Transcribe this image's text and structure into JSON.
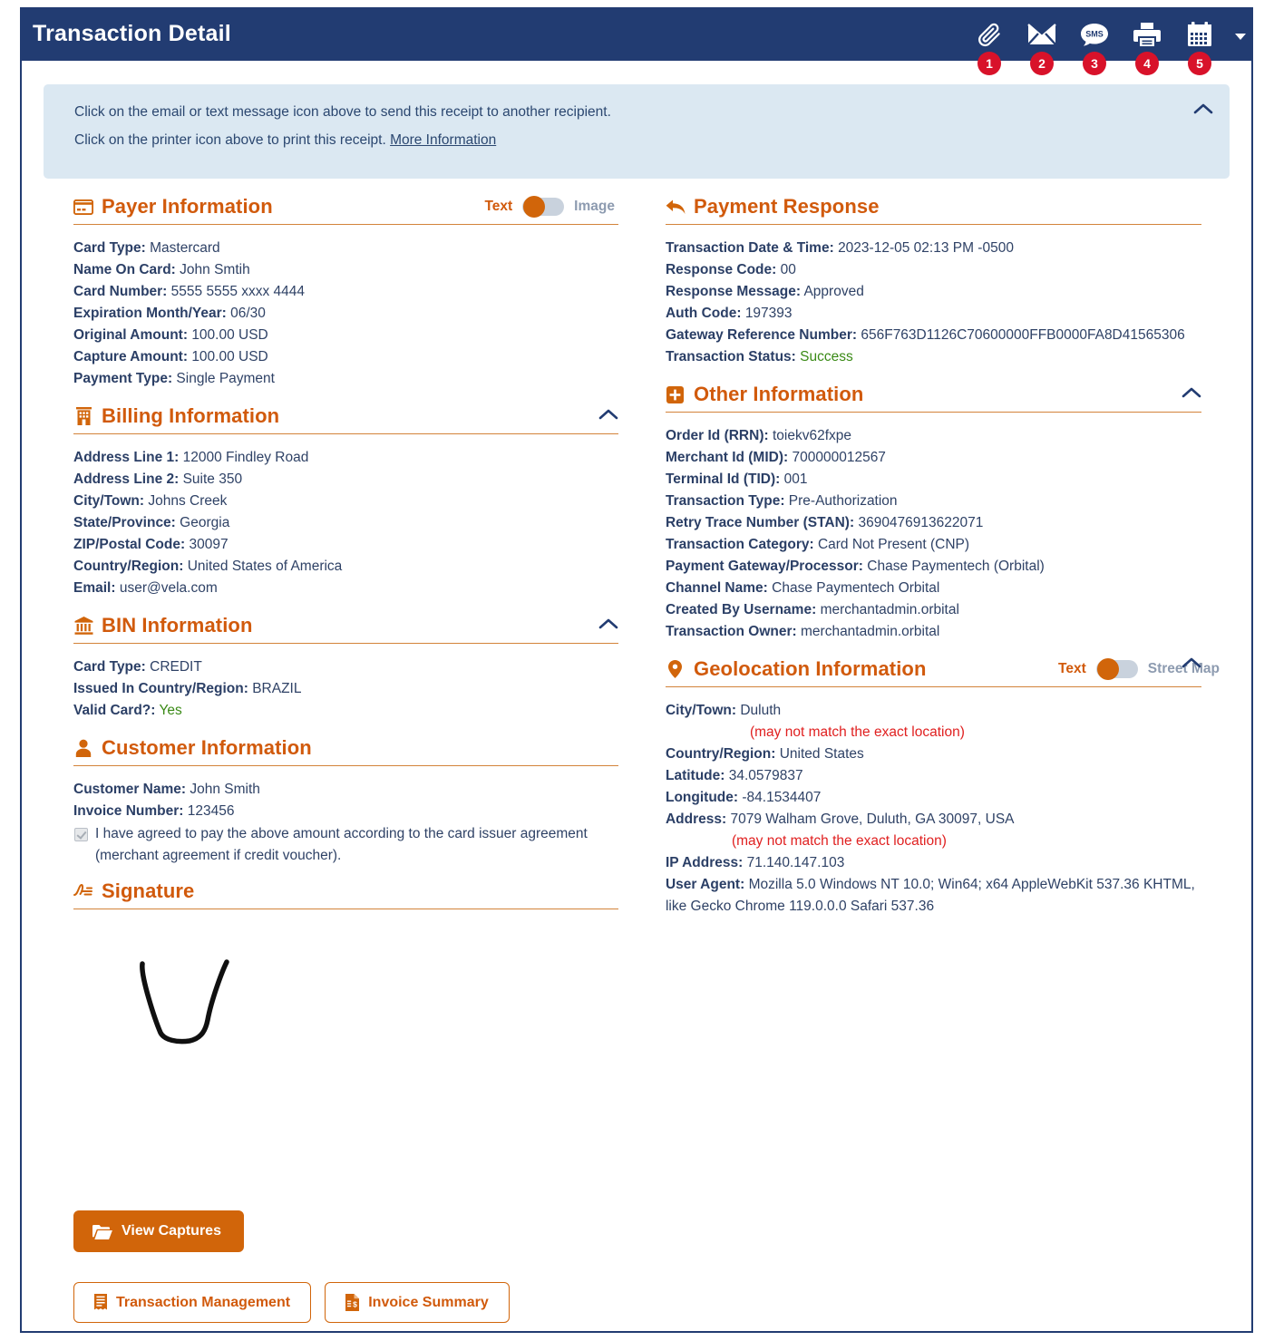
{
  "header": {
    "title": "Transaction Detail",
    "icons": [
      {
        "name": "paperclip-icon",
        "badge": "1"
      },
      {
        "name": "envelope-icon",
        "badge": "2"
      },
      {
        "name": "sms-icon",
        "badge": "3"
      },
      {
        "name": "printer-icon",
        "badge": "4"
      },
      {
        "name": "calendar-icon",
        "badge": "5"
      }
    ]
  },
  "banner": {
    "line1": "Click on the email or text message icon above to send this receipt to another recipient.",
    "line2_prefix": "Click on the printer icon above to print this receipt. ",
    "link": "More Information"
  },
  "payer": {
    "title": "Payer Information",
    "toggle": {
      "left": "Text",
      "right": "Image",
      "state": "left"
    },
    "fields": [
      {
        "key": "Card Type:",
        "value": "Mastercard"
      },
      {
        "key": "Name On Card:",
        "value": "John Smtih"
      },
      {
        "key": "Card Number:",
        "value": "5555 5555 xxxx 4444"
      },
      {
        "key": "Expiration Month/Year:",
        "value": "06/30"
      },
      {
        "key": "Original Amount:",
        "value": "100.00 USD"
      },
      {
        "key": "Capture Amount:",
        "value": "100.00 USD"
      },
      {
        "key": "Payment Type:",
        "value": "Single Payment"
      }
    ]
  },
  "billing": {
    "title": "Billing Information",
    "fields": [
      {
        "key": "Address Line 1:",
        "value": "12000 Findley Road"
      },
      {
        "key": "Address Line 2:",
        "value": "Suite 350"
      },
      {
        "key": "City/Town:",
        "value": "Johns Creek"
      },
      {
        "key": "State/Province:",
        "value": "Georgia"
      },
      {
        "key": "ZIP/Postal Code:",
        "value": "30097"
      },
      {
        "key": "Country/Region:",
        "value": "United States of America"
      },
      {
        "key": "Email:",
        "value": "user@vela.com"
      }
    ]
  },
  "bin": {
    "title": "BIN Information",
    "fields": [
      {
        "key": "Card Type:",
        "value": "CREDIT"
      },
      {
        "key": "Issued In Country/Region:",
        "value": "BRAZIL"
      }
    ],
    "valid_card_key": "Valid Card?:",
    "valid_card_value": "Yes"
  },
  "customer": {
    "title": "Customer Information",
    "fields": [
      {
        "key": "Customer Name:",
        "value": "John Smith"
      },
      {
        "key": "Invoice Number:",
        "value": "123456"
      }
    ],
    "agreement": "I have agreed to pay the above amount according to the card issuer agreement (merchant agreement if credit voucher).",
    "agreement_checked": true
  },
  "signature": {
    "title": "Signature"
  },
  "payment_response": {
    "title": "Payment Response",
    "fields": [
      {
        "key": "Transaction Date & Time:",
        "value": "2023-12-05 02:13 PM -0500"
      },
      {
        "key": "Response Code:",
        "value": "00"
      },
      {
        "key": "Response Message:",
        "value": "Approved"
      },
      {
        "key": "Auth Code:",
        "value": "197393"
      },
      {
        "key": "Gateway Reference Number:",
        "value": "656F763D1126C70600000FFB0000FA8D41565306"
      }
    ],
    "status_key": "Transaction Status:",
    "status_value": "Success"
  },
  "other": {
    "title": "Other Information",
    "fields": [
      {
        "key": "Order Id (RRN):",
        "value": "toiekv62fxpe"
      },
      {
        "key": "Merchant Id (MID):",
        "value": "700000012567"
      },
      {
        "key": "Terminal Id (TID):",
        "value": "001"
      },
      {
        "key": "Transaction Type:",
        "value": "Pre-Authorization"
      },
      {
        "key": "Retry Trace Number (STAN):",
        "value": "3690476913622071"
      },
      {
        "key": "Transaction Category:",
        "value": "Card Not Present (CNP)"
      },
      {
        "key": "Payment Gateway/Processor:",
        "value": "Chase Paymentech (Orbital)"
      },
      {
        "key": "Channel Name:",
        "value": "Chase Paymentech Orbital"
      },
      {
        "key": "Created By Username:",
        "value": "merchantadmin.orbital"
      },
      {
        "key": "Transaction Owner:",
        "value": "merchantadmin.orbital"
      }
    ]
  },
  "geolocation": {
    "title": "Geolocation Information",
    "toggle": {
      "left": "Text",
      "right": "Street Map",
      "state": "left"
    },
    "city_key": "City/Town:",
    "city_value": "Duluth",
    "city_note": "(may not match the exact location)",
    "country_key": "Country/Region:",
    "country_value": "United States",
    "lat_key": "Latitude:",
    "lat_value": "34.0579837",
    "lon_key": "Longitude:",
    "lon_value": "-84.1534407",
    "address_key": "Address:",
    "address_value": "7079 Walham Grove, Duluth, GA 30097, USA",
    "address_note": "(may not match the exact location)",
    "ip_key": "IP Address:",
    "ip_value": "71.140.147.103",
    "ua_key": "User Agent:",
    "ua_value": "Mozilla 5.0 Windows NT 10.0; Win64; x64 AppleWebKit 537.36 KHTML, like Gecko Chrome 119.0.0.0 Safari 537.36"
  },
  "buttons": {
    "view_captures": "View Captures",
    "transaction_management": "Transaction Management",
    "invoice_summary": "Invoice Summary"
  },
  "colors": {
    "header_bg": "#223c72",
    "accent_orange": "#d15a0c",
    "badge_red": "#d8122a",
    "success_green": "#3a8a16",
    "warning_red": "#e02020",
    "banner_bg": "#dbe8f2"
  }
}
